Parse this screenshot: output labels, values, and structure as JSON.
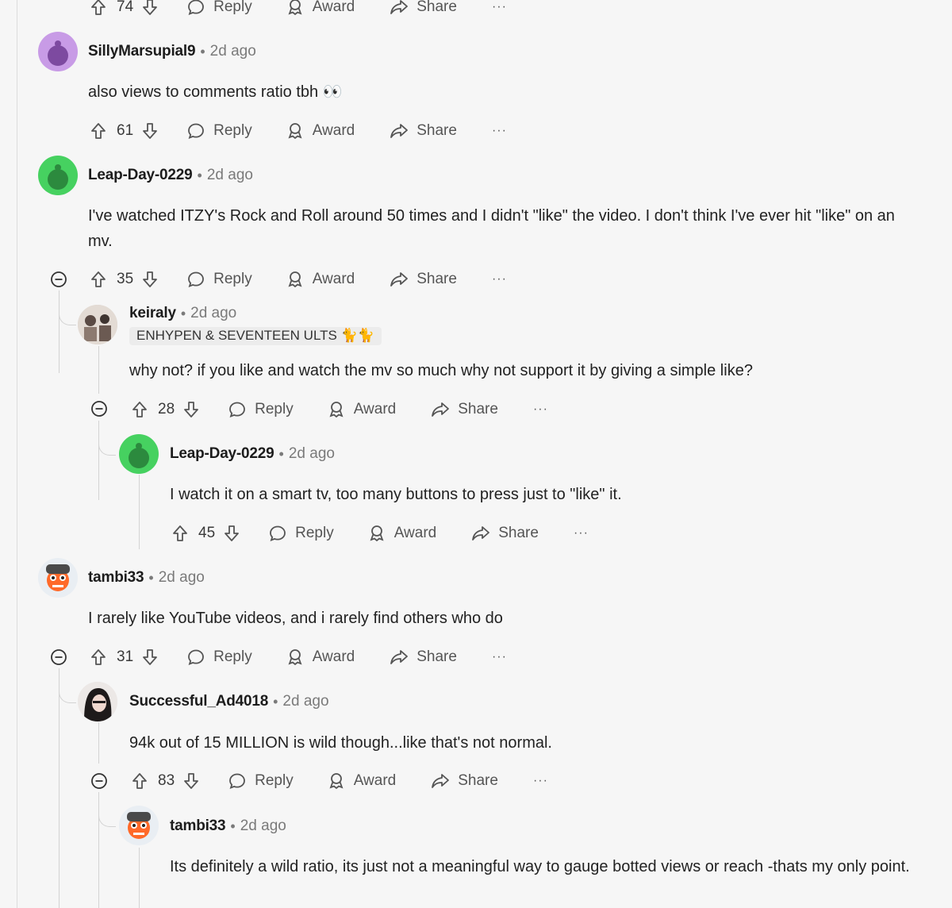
{
  "action_labels": {
    "reply": "Reply",
    "award": "Award",
    "share": "Share",
    "more": "···"
  },
  "top_partial": {
    "score": "74"
  },
  "comments": [
    {
      "author": "SillyMarsupial9",
      "time": "2d ago",
      "text": "also views to comments ratio tbh 👀",
      "score": "61",
      "avatar_color": "#b57cd8"
    },
    {
      "author": "Leap-Day-0229",
      "time": "2d ago",
      "text": "I've watched ITZY's Rock and Roll around 50 times and I didn't \"like\" the video. I don't think I've ever hit \"like\" on an mv.",
      "score": "35",
      "avatar_color": "#46d160"
    },
    {
      "author": "keiraly",
      "time": "2d ago",
      "flair": "ENHYPEN & SEVENTEEN ULTS 🐈🐈",
      "text": "why not? if you like and watch the mv so much why not support it by giving a simple like?",
      "score": "28"
    },
    {
      "author": "Leap-Day-0229",
      "time": "2d ago",
      "text": "I watch it on a smart tv, too many buttons to press just to \"like\" it.",
      "score": "45",
      "avatar_color": "#46d160"
    },
    {
      "author": "tambi33",
      "time": "2d ago",
      "text": "I rarely like YouTube videos, and i rarely find others who do",
      "score": "31"
    },
    {
      "author": "Successful_Ad4018",
      "time": "2d ago",
      "text": "94k out of 15 MILLION is wild though...like that's not normal.",
      "score": "83"
    },
    {
      "author": "tambi33",
      "time": "2d ago",
      "text": "Its definitely a wild ratio, its just not a meaningful way to gauge botted views or reach -thats my only point."
    }
  ]
}
